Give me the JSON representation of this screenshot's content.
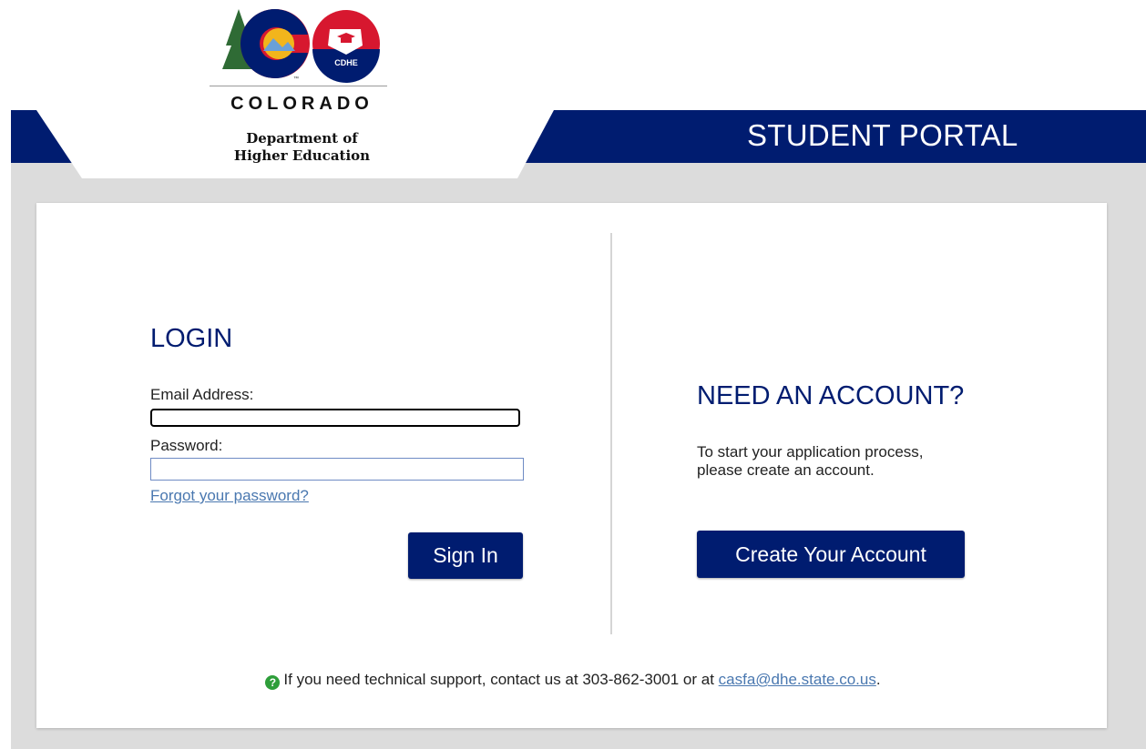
{
  "header": {
    "portal_title": "STUDENT PORTAL",
    "logo": {
      "state_name": "COLORADO",
      "dept_line1": "Department of",
      "dept_line2": "Higher Education",
      "badge_text": "CDHE",
      "trademark": "™"
    }
  },
  "login": {
    "heading": "LOGIN",
    "email_label": "Email Address:",
    "email_value": "",
    "password_label": "Password:",
    "password_value": "",
    "forgot_link": "Forgot your password?",
    "signin_button": "Sign In"
  },
  "account": {
    "heading": "NEED AN ACCOUNT?",
    "text_line1": "To start your application process,",
    "text_line2": "please create an account.",
    "create_button": "Create Your Account"
  },
  "support": {
    "text": "If you need technical support, contact us at 303-862-3001 or at ",
    "email": "casfa@dhe.state.co.us",
    "suffix": "."
  },
  "colors": {
    "brand_navy": "#001c70",
    "link_blue": "#4a78b0",
    "background_grey": "#dcdcdc",
    "logo_red": "#d7172f",
    "logo_gold": "#f2b51c",
    "logo_green": "#2f6b35"
  }
}
